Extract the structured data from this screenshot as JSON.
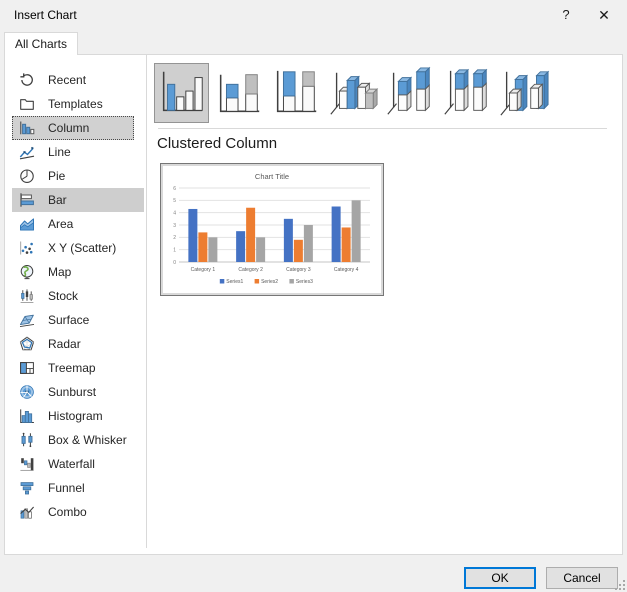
{
  "window": {
    "title": "Insert Chart",
    "help_glyph": "?",
    "close_glyph": "✕"
  },
  "tabs": [
    {
      "label": "All Charts",
      "active": true
    }
  ],
  "sidebar": {
    "items": [
      {
        "label": "Recent",
        "icon": "recent-icon",
        "state": "normal"
      },
      {
        "label": "Templates",
        "icon": "templates-icon",
        "state": "normal"
      },
      {
        "label": "Column",
        "icon": "column-icon",
        "state": "selected"
      },
      {
        "label": "Line",
        "icon": "line-icon",
        "state": "normal"
      },
      {
        "label": "Pie",
        "icon": "pie-icon",
        "state": "normal"
      },
      {
        "label": "Bar",
        "icon": "bar-icon",
        "state": "highlighted"
      },
      {
        "label": "Area",
        "icon": "area-icon",
        "state": "normal"
      },
      {
        "label": "X Y (Scatter)",
        "icon": "scatter-icon",
        "state": "normal"
      },
      {
        "label": "Map",
        "icon": "map-icon",
        "state": "normal"
      },
      {
        "label": "Stock",
        "icon": "stock-icon",
        "state": "normal"
      },
      {
        "label": "Surface",
        "icon": "surface-icon",
        "state": "normal"
      },
      {
        "label": "Radar",
        "icon": "radar-icon",
        "state": "normal"
      },
      {
        "label": "Treemap",
        "icon": "treemap-icon",
        "state": "normal"
      },
      {
        "label": "Sunburst",
        "icon": "sunburst-icon",
        "state": "normal"
      },
      {
        "label": "Histogram",
        "icon": "histogram-icon",
        "state": "normal"
      },
      {
        "label": "Box & Whisker",
        "icon": "box-whisker-icon",
        "state": "normal"
      },
      {
        "label": "Waterfall",
        "icon": "waterfall-icon",
        "state": "normal"
      },
      {
        "label": "Funnel",
        "icon": "funnel-icon",
        "state": "normal"
      },
      {
        "label": "Combo",
        "icon": "combo-icon",
        "state": "normal"
      }
    ]
  },
  "subtypes": {
    "selected_index": 0,
    "items": [
      {
        "icon": "clustered-column-icon"
      },
      {
        "icon": "stacked-column-icon"
      },
      {
        "icon": "100-stacked-column-icon"
      },
      {
        "icon": "3d-clustered-column-icon"
      },
      {
        "icon": "3d-stacked-column-icon"
      },
      {
        "icon": "3d-100-stacked-column-icon"
      },
      {
        "icon": "3d-column-icon"
      }
    ]
  },
  "preview": {
    "heading": "Clustered Column"
  },
  "chart_data": {
    "type": "bar",
    "title": "Chart Title",
    "categories": [
      "Category 1",
      "Category 2",
      "Category 3",
      "Category 4"
    ],
    "series": [
      {
        "name": "Series1",
        "color": "#4472C4",
        "values": [
          4.3,
          2.5,
          3.5,
          4.5
        ]
      },
      {
        "name": "Series2",
        "color": "#ED7D31",
        "values": [
          2.4,
          4.4,
          1.8,
          2.8
        ]
      },
      {
        "name": "Series3",
        "color": "#A5A5A5",
        "values": [
          2.0,
          2.0,
          3.0,
          5.0
        ]
      }
    ],
    "ylim": [
      0,
      6
    ],
    "yticks": [
      0,
      1,
      2,
      3,
      4,
      5,
      6
    ],
    "grid": true,
    "legend_position": "bottom"
  },
  "footer": {
    "ok_label": "OK",
    "cancel_label": "Cancel"
  },
  "colors": {
    "accent_blue": "#0078d7",
    "selection_gray": "#d1d1d1",
    "series_blue": "#4472C4",
    "series_orange": "#ED7D31",
    "series_gray": "#A5A5A5"
  }
}
